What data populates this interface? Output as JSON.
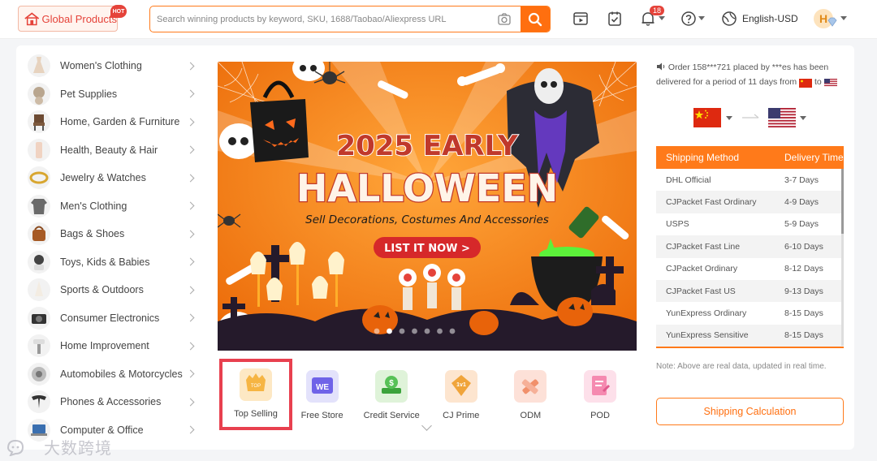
{
  "header": {
    "logo_label": "Global Products",
    "hot_badge": "HOT",
    "search_placeholder": "Search winning products by keyword, SKU, 1688/Taobao/Aliexpress URL",
    "notification_count": "18",
    "language_currency": "English-USD",
    "avatar_initial": "H"
  },
  "categories": [
    {
      "label": "Women's Clothing",
      "icon": "dress-icon"
    },
    {
      "label": "Pet Supplies",
      "icon": "pet-icon"
    },
    {
      "label": "Home, Garden & Furniture",
      "icon": "chair-icon"
    },
    {
      "label": "Health, Beauty & Hair",
      "icon": "beauty-icon"
    },
    {
      "label": "Jewelry & Watches",
      "icon": "ring-icon"
    },
    {
      "label": "Men's Clothing",
      "icon": "shirt-icon"
    },
    {
      "label": "Bags & Shoes",
      "icon": "bag-icon"
    },
    {
      "label": "Toys, Kids & Babies",
      "icon": "toy-icon"
    },
    {
      "label": "Sports & Outdoors",
      "icon": "sports-icon"
    },
    {
      "label": "Consumer Electronics",
      "icon": "camera-icon"
    },
    {
      "label": "Home Improvement",
      "icon": "tool-icon"
    },
    {
      "label": "Automobiles & Motorcycles",
      "icon": "car-icon"
    },
    {
      "label": "Phones & Accessories",
      "icon": "phone-icon"
    },
    {
      "label": "Computer & Office",
      "icon": "laptop-icon"
    }
  ],
  "banner": {
    "year_line": "2025 EARLY",
    "title": "HALLOWEEN",
    "subtitle": "Sell Decorations, Costumes And Accessories",
    "cta": "LIST IT NOW >",
    "slide_count": 7,
    "active_slide": 2
  },
  "quick_links": [
    {
      "label": "Top Selling",
      "icon": "top-selling-icon",
      "color": "#fde8c4",
      "selected": true
    },
    {
      "label": "Free Store",
      "icon": "free-store-icon",
      "color": "#e3e2fb"
    },
    {
      "label": "Credit Service",
      "icon": "credit-service-icon",
      "color": "#dff3d9"
    },
    {
      "label": "CJ Prime",
      "icon": "cj-prime-icon",
      "color": "#fde5cf"
    },
    {
      "label": "ODM",
      "icon": "odm-icon",
      "color": "#fde1d8"
    },
    {
      "label": "POD",
      "icon": "pod-icon",
      "color": "#fde0ea"
    }
  ],
  "order_message": {
    "text": "Order 158***721 placed by ***es has been delivered for a period of 11 days from",
    "to_word": "to"
  },
  "shipping": {
    "header_method": "Shipping Method",
    "header_time": "Delivery Time",
    "rows": [
      {
        "method": "DHL Official",
        "time": "3-7 Days"
      },
      {
        "method": "CJPacket Fast Ordinary",
        "time": "4-9 Days"
      },
      {
        "method": "USPS",
        "time": "5-9 Days"
      },
      {
        "method": "CJPacket Fast Line",
        "time": "6-10 Days"
      },
      {
        "method": "CJPacket Ordinary",
        "time": "8-12 Days"
      },
      {
        "method": "CJPacket Fast US",
        "time": "9-13 Days"
      },
      {
        "method": "YunExpress Ordinary",
        "time": "8-15 Days"
      },
      {
        "method": "YunExpress Sensitive",
        "time": "8-15 Days"
      }
    ],
    "note": "Note: Above are real data, updated in real time.",
    "calc_button": "Shipping Calculation"
  },
  "watermark": "大数跨境",
  "colors": {
    "accent": "#ff6f0f",
    "brand_red": "#e5433a",
    "selected_outline": "#e8404f"
  }
}
